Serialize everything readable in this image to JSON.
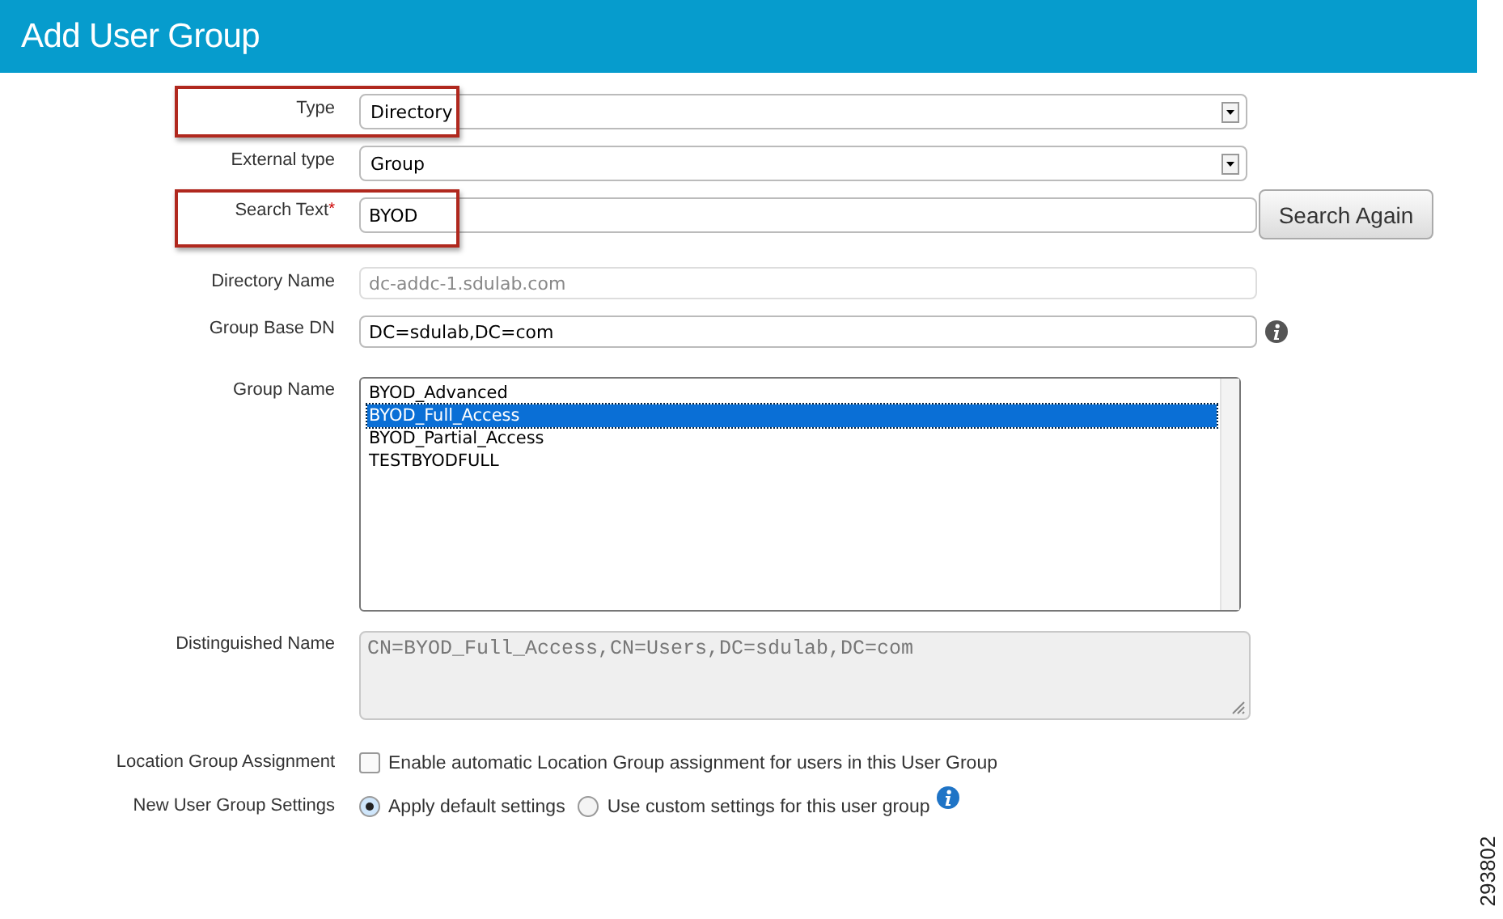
{
  "header": {
    "title": "Add User Group"
  },
  "fields": [
    {
      "kind": "select",
      "label": "Type",
      "value": "Directory",
      "highlighted": true
    },
    {
      "kind": "select",
      "label": "External type",
      "value": "Group",
      "highlighted": false
    },
    {
      "kind": "text",
      "label": "Search Text",
      "required_mark": "*",
      "value": "BYOD",
      "highlighted": true,
      "button": "Search Again"
    },
    {
      "kind": "readonly",
      "label": "Directory Name",
      "value": "dc-addc-1.sdulab.com",
      "highlighted": false
    },
    {
      "kind": "text",
      "label": "Group Base DN",
      "value": "DC=sdulab,DC=com",
      "info": true,
      "highlighted": false
    },
    {
      "kind": "list",
      "label": "Group Name",
      "highlighted": false,
      "items": [
        {
          "label": "BYOD_Advanced",
          "selected": false
        },
        {
          "label": "BYOD_Full_Access",
          "selected": true
        },
        {
          "label": "BYOD_Partial_Access",
          "selected": false
        },
        {
          "label": "TESTBYODFULL",
          "selected": false
        }
      ]
    },
    {
      "kind": "textarea",
      "label": "Distinguished Name",
      "value": "CN=BYOD_Full_Access,CN=Users,DC=sdulab,DC=com",
      "highlighted": false
    },
    {
      "kind": "checkbox",
      "label": "Location Group Assignment",
      "highlighted": false,
      "options": [
        {
          "label": "Enable automatic Location Group assignment for users in this User Group",
          "checked": false
        }
      ]
    },
    {
      "kind": "radio",
      "label": "New User Group Settings",
      "highlighted": false,
      "info": true,
      "options": [
        {
          "label": "Apply default settings",
          "selected": true
        },
        {
          "label": "Use custom settings for this user group",
          "selected": false
        }
      ]
    }
  ],
  "figure_number": "293802"
}
